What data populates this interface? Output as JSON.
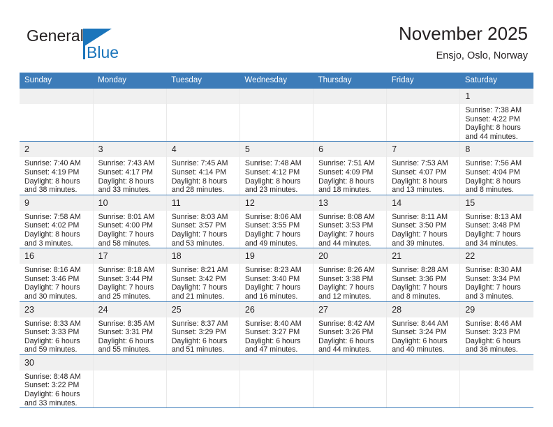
{
  "brand": {
    "name_part1": "General",
    "name_part2": "Blue",
    "accent_color": "#1b75bb"
  },
  "header": {
    "title": "November 2025",
    "subtitle": "Ensjo, Oslo, Norway",
    "header_bg_color": "#3d7cb9",
    "daynum_bg_color": "#f0f0f0"
  },
  "weekdays": [
    "Sunday",
    "Monday",
    "Tuesday",
    "Wednesday",
    "Thursday",
    "Friday",
    "Saturday"
  ],
  "labels": {
    "sunrise": "Sunrise:",
    "sunset": "Sunset:",
    "daylight": "Daylight:"
  },
  "weeks": [
    [
      {
        "empty": true
      },
      {
        "empty": true
      },
      {
        "empty": true
      },
      {
        "empty": true
      },
      {
        "empty": true
      },
      {
        "empty": true
      },
      {
        "day": "1",
        "sunrise": "Sunrise: 7:38 AM",
        "sunset": "Sunset: 4:22 PM",
        "daylight1": "Daylight: 8 hours",
        "daylight2": "and 44 minutes."
      }
    ],
    [
      {
        "day": "2",
        "sunrise": "Sunrise: 7:40 AM",
        "sunset": "Sunset: 4:19 PM",
        "daylight1": "Daylight: 8 hours",
        "daylight2": "and 38 minutes."
      },
      {
        "day": "3",
        "sunrise": "Sunrise: 7:43 AM",
        "sunset": "Sunset: 4:17 PM",
        "daylight1": "Daylight: 8 hours",
        "daylight2": "and 33 minutes."
      },
      {
        "day": "4",
        "sunrise": "Sunrise: 7:45 AM",
        "sunset": "Sunset: 4:14 PM",
        "daylight1": "Daylight: 8 hours",
        "daylight2": "and 28 minutes."
      },
      {
        "day": "5",
        "sunrise": "Sunrise: 7:48 AM",
        "sunset": "Sunset: 4:12 PM",
        "daylight1": "Daylight: 8 hours",
        "daylight2": "and 23 minutes."
      },
      {
        "day": "6",
        "sunrise": "Sunrise: 7:51 AM",
        "sunset": "Sunset: 4:09 PM",
        "daylight1": "Daylight: 8 hours",
        "daylight2": "and 18 minutes."
      },
      {
        "day": "7",
        "sunrise": "Sunrise: 7:53 AM",
        "sunset": "Sunset: 4:07 PM",
        "daylight1": "Daylight: 8 hours",
        "daylight2": "and 13 minutes."
      },
      {
        "day": "8",
        "sunrise": "Sunrise: 7:56 AM",
        "sunset": "Sunset: 4:04 PM",
        "daylight1": "Daylight: 8 hours",
        "daylight2": "and 8 minutes."
      }
    ],
    [
      {
        "day": "9",
        "sunrise": "Sunrise: 7:58 AM",
        "sunset": "Sunset: 4:02 PM",
        "daylight1": "Daylight: 8 hours",
        "daylight2": "and 3 minutes."
      },
      {
        "day": "10",
        "sunrise": "Sunrise: 8:01 AM",
        "sunset": "Sunset: 4:00 PM",
        "daylight1": "Daylight: 7 hours",
        "daylight2": "and 58 minutes."
      },
      {
        "day": "11",
        "sunrise": "Sunrise: 8:03 AM",
        "sunset": "Sunset: 3:57 PM",
        "daylight1": "Daylight: 7 hours",
        "daylight2": "and 53 minutes."
      },
      {
        "day": "12",
        "sunrise": "Sunrise: 8:06 AM",
        "sunset": "Sunset: 3:55 PM",
        "daylight1": "Daylight: 7 hours",
        "daylight2": "and 49 minutes."
      },
      {
        "day": "13",
        "sunrise": "Sunrise: 8:08 AM",
        "sunset": "Sunset: 3:53 PM",
        "daylight1": "Daylight: 7 hours",
        "daylight2": "and 44 minutes."
      },
      {
        "day": "14",
        "sunrise": "Sunrise: 8:11 AM",
        "sunset": "Sunset: 3:50 PM",
        "daylight1": "Daylight: 7 hours",
        "daylight2": "and 39 minutes."
      },
      {
        "day": "15",
        "sunrise": "Sunrise: 8:13 AM",
        "sunset": "Sunset: 3:48 PM",
        "daylight1": "Daylight: 7 hours",
        "daylight2": "and 34 minutes."
      }
    ],
    [
      {
        "day": "16",
        "sunrise": "Sunrise: 8:16 AM",
        "sunset": "Sunset: 3:46 PM",
        "daylight1": "Daylight: 7 hours",
        "daylight2": "and 30 minutes."
      },
      {
        "day": "17",
        "sunrise": "Sunrise: 8:18 AM",
        "sunset": "Sunset: 3:44 PM",
        "daylight1": "Daylight: 7 hours",
        "daylight2": "and 25 minutes."
      },
      {
        "day": "18",
        "sunrise": "Sunrise: 8:21 AM",
        "sunset": "Sunset: 3:42 PM",
        "daylight1": "Daylight: 7 hours",
        "daylight2": "and 21 minutes."
      },
      {
        "day": "19",
        "sunrise": "Sunrise: 8:23 AM",
        "sunset": "Sunset: 3:40 PM",
        "daylight1": "Daylight: 7 hours",
        "daylight2": "and 16 minutes."
      },
      {
        "day": "20",
        "sunrise": "Sunrise: 8:26 AM",
        "sunset": "Sunset: 3:38 PM",
        "daylight1": "Daylight: 7 hours",
        "daylight2": "and 12 minutes."
      },
      {
        "day": "21",
        "sunrise": "Sunrise: 8:28 AM",
        "sunset": "Sunset: 3:36 PM",
        "daylight1": "Daylight: 7 hours",
        "daylight2": "and 8 minutes."
      },
      {
        "day": "22",
        "sunrise": "Sunrise: 8:30 AM",
        "sunset": "Sunset: 3:34 PM",
        "daylight1": "Daylight: 7 hours",
        "daylight2": "and 3 minutes."
      }
    ],
    [
      {
        "day": "23",
        "sunrise": "Sunrise: 8:33 AM",
        "sunset": "Sunset: 3:33 PM",
        "daylight1": "Daylight: 6 hours",
        "daylight2": "and 59 minutes."
      },
      {
        "day": "24",
        "sunrise": "Sunrise: 8:35 AM",
        "sunset": "Sunset: 3:31 PM",
        "daylight1": "Daylight: 6 hours",
        "daylight2": "and 55 minutes."
      },
      {
        "day": "25",
        "sunrise": "Sunrise: 8:37 AM",
        "sunset": "Sunset: 3:29 PM",
        "daylight1": "Daylight: 6 hours",
        "daylight2": "and 51 minutes."
      },
      {
        "day": "26",
        "sunrise": "Sunrise: 8:40 AM",
        "sunset": "Sunset: 3:27 PM",
        "daylight1": "Daylight: 6 hours",
        "daylight2": "and 47 minutes."
      },
      {
        "day": "27",
        "sunrise": "Sunrise: 8:42 AM",
        "sunset": "Sunset: 3:26 PM",
        "daylight1": "Daylight: 6 hours",
        "daylight2": "and 44 minutes."
      },
      {
        "day": "28",
        "sunrise": "Sunrise: 8:44 AM",
        "sunset": "Sunset: 3:24 PM",
        "daylight1": "Daylight: 6 hours",
        "daylight2": "and 40 minutes."
      },
      {
        "day": "29",
        "sunrise": "Sunrise: 8:46 AM",
        "sunset": "Sunset: 3:23 PM",
        "daylight1": "Daylight: 6 hours",
        "daylight2": "and 36 minutes."
      }
    ],
    [
      {
        "day": "30",
        "sunrise": "Sunrise: 8:48 AM",
        "sunset": "Sunset: 3:22 PM",
        "daylight1": "Daylight: 6 hours",
        "daylight2": "and 33 minutes."
      },
      {
        "empty": true
      },
      {
        "empty": true
      },
      {
        "empty": true
      },
      {
        "empty": true
      },
      {
        "empty": true
      },
      {
        "empty": true
      }
    ]
  ]
}
